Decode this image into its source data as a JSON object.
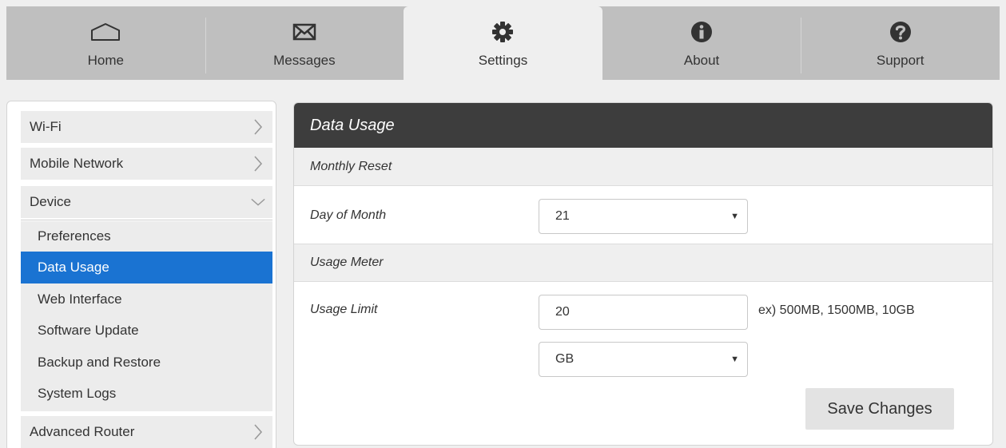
{
  "nav": {
    "tabs": [
      {
        "label": "Home",
        "icon": "home-icon",
        "active": false
      },
      {
        "label": "Messages",
        "icon": "envelope-icon",
        "active": false
      },
      {
        "label": "Settings",
        "icon": "gear-icon",
        "active": true
      },
      {
        "label": "About",
        "icon": "info-icon",
        "active": false
      },
      {
        "label": "Support",
        "icon": "question-icon",
        "active": false
      }
    ]
  },
  "sidebar": {
    "items": [
      {
        "label": "Wi-Fi",
        "chevron": "right"
      },
      {
        "label": "Mobile Network",
        "chevron": "right"
      },
      {
        "label": "Device",
        "chevron": "down",
        "expanded": true
      },
      {
        "label": "Advanced Router",
        "chevron": "right"
      }
    ],
    "device_subitems": [
      {
        "label": "Preferences",
        "active": false
      },
      {
        "label": "Data Usage",
        "active": true
      },
      {
        "label": "Web Interface",
        "active": false
      },
      {
        "label": "Software Update",
        "active": false
      },
      {
        "label": "Backup and Restore",
        "active": false
      },
      {
        "label": "System Logs",
        "active": false
      }
    ]
  },
  "main": {
    "title": "Data Usage",
    "monthly_reset": {
      "section_label": "Monthly Reset",
      "day_label": "Day of Month",
      "day_value": "21"
    },
    "usage_meter": {
      "section_label": "Usage Meter",
      "limit_label": "Usage Limit",
      "limit_value": "20",
      "limit_hint": "ex) 500MB, 1500MB, 10GB",
      "unit_value": "GB"
    },
    "save_label": "Save Changes"
  },
  "colors": {
    "accent": "#1a73d2",
    "header_bg": "#3d3d3d",
    "nav_bg": "#bfbfbf"
  }
}
